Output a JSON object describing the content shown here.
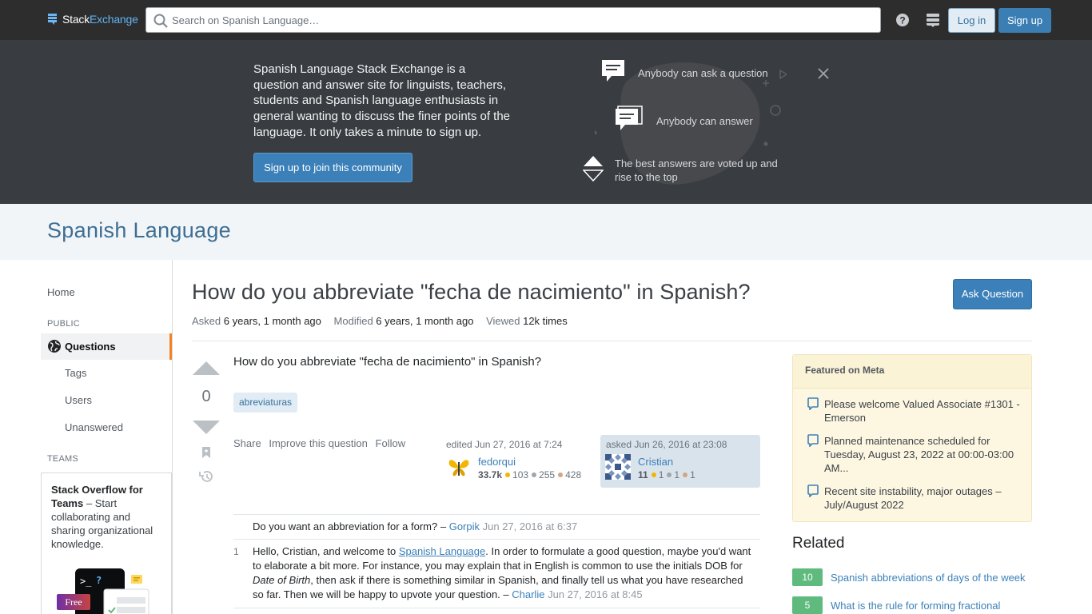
{
  "topbar": {
    "logo_stack": "Stack",
    "logo_exchange": "Exchange",
    "search_placeholder": "Search on Spanish Language…",
    "login_label": "Log in",
    "signup_label": "Sign up"
  },
  "hero": {
    "text": "Spanish Language Stack Exchange is a question and answer site for linguists, teachers, students and Spanish language enthusiasts in general wanting to discuss the finer points of the language. It only takes a minute to sign up.",
    "join_label": "Sign up to join this community",
    "feature_ask": "Anybody can ask a question",
    "feature_answer": "Anybody can answer",
    "feature_vote": "The best answers are voted up and rise to the top"
  },
  "site": {
    "name": "Spanish Language"
  },
  "nav": {
    "home": "Home",
    "public_heading": "PUBLIC",
    "questions": "Questions",
    "tags": "Tags",
    "users": "Users",
    "unanswered": "Unanswered",
    "teams_heading": "TEAMS",
    "teams_title": "Stack Overflow for Teams",
    "teams_text": " – Start collaborating and sharing organizational knowledge.",
    "free_badge": "Free"
  },
  "question": {
    "title": "How do you abbreviate \"fecha de nacimiento\" in Spanish?",
    "ask_label": "Ask Question",
    "asked_label": "Asked",
    "asked_value": "6 years, 1 month ago",
    "modified_label": "Modified",
    "modified_value": "6 years, 1 month ago",
    "viewed_label": "Viewed",
    "viewed_value": "12k times",
    "score": "0",
    "body": "How do you abbreviate \"fecha de nacimiento\" in Spanish?",
    "tag": "abreviaturas",
    "menu_share": "Share",
    "menu_improve": "Improve this question",
    "menu_follow": "Follow",
    "edited": {
      "when": "edited Jun 27, 2016 at 7:24",
      "user": "fedorqui",
      "rep": "33.7k",
      "gold": "103",
      "silver": "255",
      "bronze": "428"
    },
    "asker": {
      "when": "asked Jun 26, 2016 at 23:08",
      "user": "Cristian",
      "rep": "11",
      "gold": "1",
      "silver": "1",
      "bronze": "1"
    }
  },
  "comments": [
    {
      "score": "",
      "text": "Do you want an abbreviation for a form? – ",
      "user": "Gorpik",
      "time": "Jun 27, 2016 at 6:37"
    },
    {
      "score": "1",
      "text_a": "Hello, Cristian, and welcome to ",
      "link": "Spanish Language",
      "text_b": ". In order to formulate a good question, maybe you'd want to elaborate a bit more. For instance, you may explain that in English is common to use the initials DOB for ",
      "italic": "Date of Birth",
      "text_c": ", then ask if there is something similar in Spanish, and finally tell us what you have researched so far. Then we will be happy to upvote your question. – ",
      "user": "Charlie",
      "time": "Jun 27, 2016 at 8:45"
    }
  ],
  "featured": {
    "heading": "Featured on Meta",
    "items": [
      "Please welcome Valued Associate #1301 - Emerson",
      "Planned maintenance scheduled for Tuesday, August 23, 2022 at 00:00-03:00 AM...",
      "Recent site instability, major outages – July/August 2022"
    ]
  },
  "related": {
    "heading": "Related",
    "items": [
      {
        "score": "10",
        "title": "Spanish abbreviations of days of the week"
      },
      {
        "score": "5",
        "title": "What is the rule for forming fractional"
      }
    ]
  },
  "colors": {
    "topbar": "#2d2d2d",
    "hero": "#393d41",
    "accent": "#3b80b8",
    "nav_active": "#f48225",
    "answered_badge": "#5eba7d"
  }
}
